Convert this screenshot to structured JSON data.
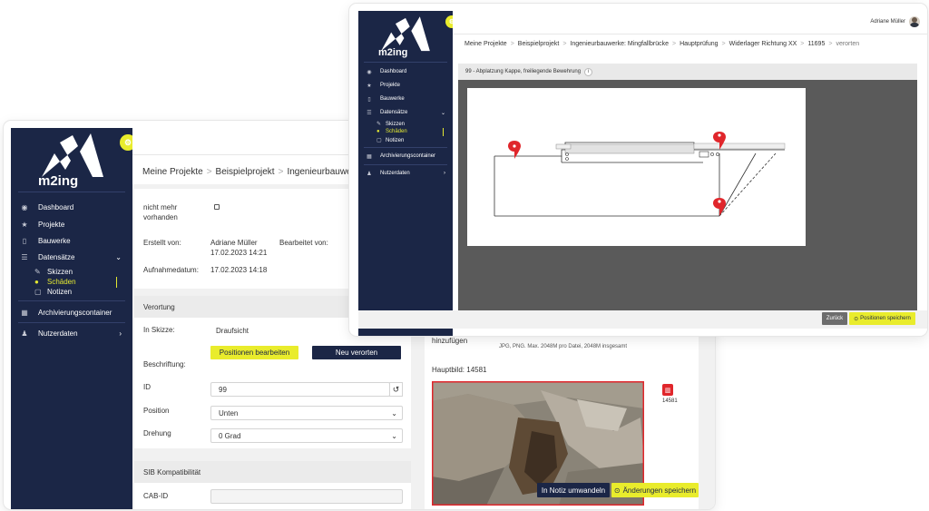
{
  "winA": {
    "logo_text": "m2ing",
    "nav": [
      {
        "icon": "dashboard-icon",
        "label": "Dashboard"
      },
      {
        "icon": "star-icon",
        "label": "Projekte"
      },
      {
        "icon": "building-icon",
        "label": "Bauwerke"
      },
      {
        "icon": "list-icon",
        "label": "Datensätze"
      },
      {
        "icon": "archive-icon",
        "label": "Archivierungscontainer"
      },
      {
        "icon": "user-icon",
        "label": "Nutzerdaten"
      }
    ],
    "sub": [
      {
        "label": "Skizzen"
      },
      {
        "label": "Schäden"
      },
      {
        "label": "Notizen"
      }
    ],
    "breadcrumb": [
      "Meine Projekte",
      "Beispielprojekt",
      "Ingenieurbauwerke: M"
    ],
    "form": {
      "nicht_mehr_label": "nicht mehr vorhanden",
      "erstellt_label": "Erstellt von:",
      "erstellt_value": "Adriane Müller",
      "erstellt_date": "17.02.2023 14:21",
      "bearbeitet_label": "Bearbeitet von:",
      "aufnahme_label": "Aufnahmedatum:",
      "aufnahme_value": "17.02.2023 14:18",
      "verortung_section": "Verortung",
      "skizze_label": "In Skizze:",
      "skizze_value": "Draufsicht",
      "btn_positionen": "Positionen bearbeiten",
      "btn_neu": "Neu verorten",
      "beschriftung_label": "Beschriftung:",
      "id_label": "ID",
      "id_value": "99",
      "position_label": "Position",
      "position_value": "Unten",
      "drehung_label": "Drehung",
      "drehung_value": "0 Grad",
      "sib_section": "SIB Kompatibilität",
      "cab_label": "CAB-ID"
    },
    "right": {
      "hinzufuegen": "hinzufügen",
      "file_hint": "JPG, PNG. Max. 2048M pro Datei, 2048M insgesamt",
      "hauptbild_label": "Hauptbild: 14581",
      "image_id": "14581",
      "btn_notiz": "In Notiz umwandeln",
      "btn_speichern": "Änderungen speichern"
    }
  },
  "winB": {
    "logo_text": "m2ing",
    "nav": [
      {
        "icon": "dashboard-icon",
        "label": "Dashboard"
      },
      {
        "icon": "star-icon",
        "label": "Projekte"
      },
      {
        "icon": "building-icon",
        "label": "Bauwerke"
      },
      {
        "icon": "list-icon",
        "label": "Datensätze"
      },
      {
        "icon": "archive-icon",
        "label": "Archivierungscontainer"
      },
      {
        "icon": "user-icon",
        "label": "Nutzerdaten"
      }
    ],
    "sub": [
      {
        "label": "Skizzen"
      },
      {
        "label": "Schäden"
      },
      {
        "label": "Notizen"
      }
    ],
    "user_name": "Adriane Müller",
    "breadcrumb": [
      "Meine Projekte",
      "Beispielprojekt",
      "Ingenieurbauwerke: Mingfallbrücke",
      "Hauptprüfung",
      "Widerlager Richtung XX",
      "11695",
      "verorten"
    ],
    "damage_title": "99 - Abplatzung Kappe, freiliegende Bewehrung",
    "info_icon_text": "i",
    "btn_zurueck": "Zurück",
    "btn_positionen_speichern": "Positionen speichern"
  },
  "colors": {
    "navy": "#1b2646",
    "accent_yellow": "#e9ec2c",
    "marker_red": "#e0262b",
    "delete_red": "#e0262b"
  }
}
